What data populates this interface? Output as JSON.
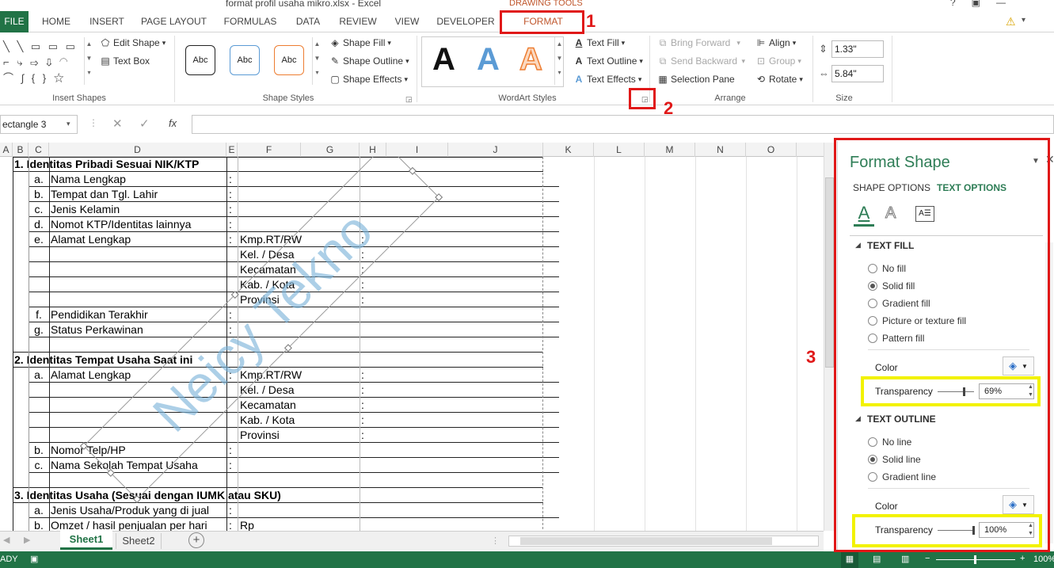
{
  "window": {
    "title": "format profil usaha mikro.xlsx - Excel",
    "context_tab_group": "DRAWING TOOLS"
  },
  "tabs": [
    "FILE",
    "HOME",
    "INSERT",
    "PAGE LAYOUT",
    "FORMULAS",
    "DATA",
    "REVIEW",
    "VIEW",
    "DEVELOPER",
    "FORMAT"
  ],
  "ribbon": {
    "insert_shapes": {
      "label": "Insert Shapes",
      "edit_shape": "Edit Shape",
      "text_box": "Text Box"
    },
    "shape_styles": {
      "label": "Shape Styles",
      "presets": [
        "Abc",
        "Abc",
        "Abc"
      ],
      "shape_fill": "Shape Fill",
      "shape_outline": "Shape Outline",
      "shape_effects": "Shape Effects"
    },
    "wordart_styles": {
      "label": "WordArt Styles",
      "letters": [
        "A",
        "A",
        "A"
      ],
      "text_fill": "Text Fill",
      "text_outline": "Text Outline",
      "text_effects": "Text Effects"
    },
    "arrange": {
      "label": "Arrange",
      "bring_forward": "Bring Forward",
      "send_backward": "Send Backward",
      "selection_pane": "Selection Pane",
      "align": "Align",
      "group": "Group",
      "rotate": "Rotate"
    },
    "size": {
      "label": "Size",
      "height": "1.33\"",
      "width": "5.84\""
    }
  },
  "annotations": [
    "1",
    "2",
    "3"
  ],
  "formula_bar": {
    "name_box": "ectangle 3",
    "fx": "fx",
    "content": ""
  },
  "columns": [
    "A",
    "B",
    "C",
    "D",
    "E",
    "F",
    "G",
    "H",
    "I",
    "J",
    "K",
    "L",
    "M",
    "N",
    "O"
  ],
  "rows": [
    {
      "b": "1. Identitas Pribadi Sesuai NIK/KTP",
      "head": true
    },
    {
      "c": "a.",
      "d": "Nama Lengkap",
      "e": ":"
    },
    {
      "c": "b.",
      "d": "Tempat dan Tgl. Lahir",
      "e": ":"
    },
    {
      "c": "c.",
      "d": "Jenis Kelamin",
      "e": ":"
    },
    {
      "c": "d.",
      "d": "Nomot KTP/Identitas lainnya",
      "e": ":"
    },
    {
      "c": "e.",
      "d": "Alamat Lengkap",
      "e": ":",
      "f": "Kmp.RT/RW",
      "h": ":"
    },
    {
      "f": "Kel. / Desa",
      "h": ":"
    },
    {
      "f": "Kecamatan",
      "h": ":"
    },
    {
      "f": "Kab. / Kota",
      "h": ":"
    },
    {
      "f": "Provinsi",
      "h": ":"
    },
    {
      "c": "f.",
      "d": "Pendidikan Terakhir",
      "e": ":"
    },
    {
      "c": "g.",
      "d": "Status Perkawinan",
      "e": ":"
    },
    {},
    {
      "b": "2. Identitas Tempat Usaha Saat ini",
      "head": true
    },
    {
      "c": "a.",
      "d": "Alamat Lengkap",
      "e": ":",
      "f": "Kmp.RT/RW",
      "h": ":"
    },
    {
      "f": "Kel. / Desa",
      "h": ":"
    },
    {
      "f": "Kecamatan",
      "h": ":"
    },
    {
      "f": "Kab. / Kota",
      "h": ":"
    },
    {
      "f": "Provinsi",
      "h": ":"
    },
    {
      "c": "b.",
      "d": "Nomor Telp/HP",
      "e": ":"
    },
    {
      "c": "c.",
      "d": "Nama Sekolah Tempat Usaha",
      "e": ":"
    },
    {},
    {
      "b": "3. Identitas Usaha (Sesuai dengan IUMK atau SKU)",
      "head": true
    },
    {
      "c": "a.",
      "d": "Jenis Usaha/Produk yang di jual",
      "e": ":"
    },
    {
      "c": "b.",
      "d": "Omzet / hasil penjualan per hari",
      "e": ":",
      "f": "Rp"
    }
  ],
  "watermark": "Neicy Tekno",
  "sheets": {
    "active": "Sheet1",
    "other": "Sheet2",
    "add": "+"
  },
  "status": {
    "left": "ADY",
    "zoom": "100%"
  },
  "pane": {
    "title": "Format Shape",
    "tab_shape": "SHAPE OPTIONS",
    "tab_text": "TEXT OPTIONS",
    "text_fill_title": "TEXT FILL",
    "fill_options": [
      "No fill",
      "Solid fill",
      "Gradient fill",
      "Picture or texture fill",
      "Pattern fill"
    ],
    "fill_selected": 1,
    "fill_color_label": "Color",
    "fill_transparency_label": "Transparency",
    "fill_transparency": "69%",
    "text_outline_title": "TEXT OUTLINE",
    "outline_options": [
      "No line",
      "Solid line",
      "Gradient line"
    ],
    "outline_selected": 1,
    "outline_color_label": "Color",
    "outline_transparency_label": "Transparency",
    "outline_transparency": "100%"
  },
  "colors": {
    "excel_green": "#217346",
    "accent_red": "#e01818",
    "highlight_yellow": "#f2f200",
    "format_orange": "#c0562c",
    "pane_green": "#2e7d56",
    "watermark_blue": "#7ab3d9"
  }
}
